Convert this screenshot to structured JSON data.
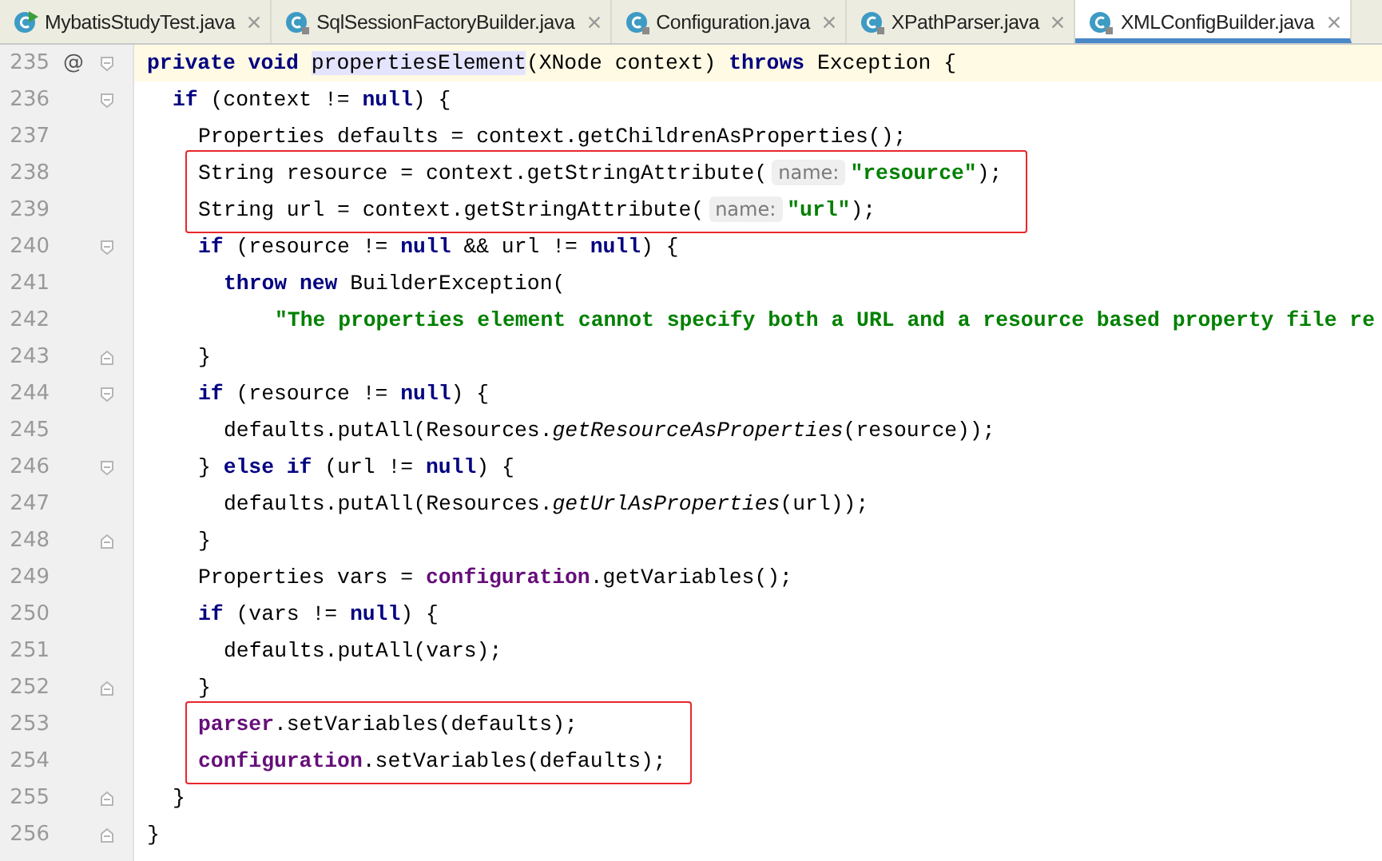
{
  "tabs": [
    {
      "label": "MybatisStudyTest.java",
      "selected": false,
      "runnable": true
    },
    {
      "label": "SqlSessionFactoryBuilder.java",
      "selected": false,
      "runnable": false
    },
    {
      "label": "Configuration.java",
      "selected": false,
      "runnable": false
    },
    {
      "label": "XPathParser.java",
      "selected": false,
      "runnable": false
    },
    {
      "label": "XMLConfigBuilder.java",
      "selected": true,
      "runnable": false
    }
  ],
  "editor": {
    "lines": [
      {
        "number": "235",
        "current": true,
        "marker": "@",
        "fold_open": true,
        "tokens": [
          {
            "kind": "kw",
            "text": "private void "
          },
          {
            "kind": "match",
            "text": "propertiesElement"
          },
          {
            "kind": "plain",
            "text": "(XNode context) "
          },
          {
            "kind": "kw",
            "text": "throws"
          },
          {
            "kind": "plain",
            "text": " Exception {"
          }
        ],
        "children": [
          {
            "number": "236",
            "current": false,
            "fold_open": true,
            "tokens": [
              {
                "kind": "kw",
                "text": "if"
              },
              {
                "kind": "plain",
                "text": " (context != "
              },
              {
                "kind": "kw",
                "text": "null"
              },
              {
                "kind": "plain",
                "text": ") {"
              }
            ],
            "children": [
              {
                "number": "237",
                "current": false,
                "tokens": [
                  {
                    "kind": "plain",
                    "text": "Properties defaults = context.getChildrenAsProperties();"
                  }
                ]
              },
              {
                "number": "238",
                "current": false,
                "boxed": true,
                "tokens": [
                  {
                    "kind": "plain",
                    "text": "String resource = context.getStringAttribute("
                  },
                  {
                    "kind": "hint",
                    "text": "name:"
                  },
                  {
                    "kind": "str",
                    "text": "\"resource\""
                  },
                  {
                    "kind": "plain",
                    "text": ");"
                  }
                ]
              },
              {
                "number": "239",
                "current": false,
                "boxed": true,
                "tokens": [
                  {
                    "kind": "plain",
                    "text": "String url = context.getStringAttribute("
                  },
                  {
                    "kind": "hint",
                    "text": "name:"
                  },
                  {
                    "kind": "str",
                    "text": "\"url\""
                  },
                  {
                    "kind": "plain",
                    "text": ");"
                  }
                ]
              },
              {
                "number": "240",
                "current": false,
                "fold_open": true,
                "tokens": [
                  {
                    "kind": "kw",
                    "text": "if"
                  },
                  {
                    "kind": "plain",
                    "text": " (resource != "
                  },
                  {
                    "kind": "kw",
                    "text": "null"
                  },
                  {
                    "kind": "plain",
                    "text": " && url != "
                  },
                  {
                    "kind": "kw",
                    "text": "null"
                  },
                  {
                    "kind": "plain",
                    "text": ") {"
                  }
                ],
                "children": [
                  {
                    "number": "241",
                    "current": false,
                    "tokens": [
                      {
                        "kind": "kw",
                        "text": "throw new "
                      },
                      {
                        "kind": "plain",
                        "text": "BuilderException("
                      }
                    ],
                    "children": [
                      {
                        "number": "242",
                        "current": false,
                        "continuation": true,
                        "tokens": [
                          {
                            "kind": "str",
                            "text": "\"The properties element cannot specify both a URL and a resource based property file re"
                          }
                        ]
                      }
                    ]
                  }
                ]
              },
              {
                "number": "243",
                "current": false,
                "fold_close": true,
                "tokens": [
                  {
                    "kind": "plain",
                    "text": "}"
                  }
                ]
              },
              {
                "number": "244",
                "current": false,
                "fold_open": true,
                "tokens": [
                  {
                    "kind": "kw",
                    "text": "if"
                  },
                  {
                    "kind": "plain",
                    "text": " (resource != "
                  },
                  {
                    "kind": "kw",
                    "text": "null"
                  },
                  {
                    "kind": "plain",
                    "text": ") {"
                  }
                ],
                "children": [
                  {
                    "number": "245",
                    "current": false,
                    "tokens": [
                      {
                        "kind": "plain",
                        "text": "defaults.putAll(Resources."
                      },
                      {
                        "kind": "static",
                        "text": "getResourceAsProperties"
                      },
                      {
                        "kind": "plain",
                        "text": "(resource));"
                      }
                    ]
                  }
                ]
              },
              {
                "number": "246",
                "current": false,
                "fold_open": true,
                "tokens": [
                  {
                    "kind": "plain",
                    "text": "} "
                  },
                  {
                    "kind": "kw",
                    "text": "else if"
                  },
                  {
                    "kind": "plain",
                    "text": " (url != "
                  },
                  {
                    "kind": "kw",
                    "text": "null"
                  },
                  {
                    "kind": "plain",
                    "text": ") {"
                  }
                ],
                "children": [
                  {
                    "number": "247",
                    "current": false,
                    "tokens": [
                      {
                        "kind": "plain",
                        "text": "defaults.putAll(Resources."
                      },
                      {
                        "kind": "static",
                        "text": "getUrlAsProperties"
                      },
                      {
                        "kind": "plain",
                        "text": "(url));"
                      }
                    ]
                  }
                ]
              },
              {
                "number": "248",
                "current": false,
                "fold_close": true,
                "tokens": [
                  {
                    "kind": "plain",
                    "text": "}"
                  }
                ]
              },
              {
                "number": "249",
                "current": false,
                "tokens": [
                  {
                    "kind": "plain",
                    "text": "Properties vars = "
                  },
                  {
                    "kind": "field",
                    "text": "configuration"
                  },
                  {
                    "kind": "plain",
                    "text": ".getVariables();"
                  }
                ]
              },
              {
                "number": "250",
                "current": false,
                "tokens": [
                  {
                    "kind": "kw",
                    "text": "if"
                  },
                  {
                    "kind": "plain",
                    "text": " (vars != "
                  },
                  {
                    "kind": "kw",
                    "text": "null"
                  },
                  {
                    "kind": "plain",
                    "text": ") {"
                  }
                ],
                "children": [
                  {
                    "number": "251",
                    "current": false,
                    "tokens": [
                      {
                        "kind": "plain",
                        "text": "defaults.putAll(vars);"
                      }
                    ]
                  }
                ]
              },
              {
                "number": "252",
                "current": false,
                "fold_close": true,
                "tokens": [
                  {
                    "kind": "plain",
                    "text": "}"
                  }
                ]
              },
              {
                "number": "253",
                "current": false,
                "boxed": true,
                "tokens": [
                  {
                    "kind": "field",
                    "text": "parser"
                  },
                  {
                    "kind": "plain",
                    "text": ".setVariables(defaults);"
                  }
                ]
              },
              {
                "number": "254",
                "current": false,
                "boxed": true,
                "tokens": [
                  {
                    "kind": "field",
                    "text": "configuration"
                  },
                  {
                    "kind": "plain",
                    "text": ".setVariables(defaults);"
                  }
                ]
              }
            ]
          },
          {
            "number": "255",
            "current": false,
            "fold_close": true,
            "tokens": [
              {
                "kind": "plain",
                "text": "}"
              }
            ]
          }
        ]
      },
      {
        "number": "256",
        "current": false,
        "fold_close": true,
        "tokens": [
          {
            "kind": "plain",
            "text": "}"
          }
        ]
      }
    ]
  }
}
